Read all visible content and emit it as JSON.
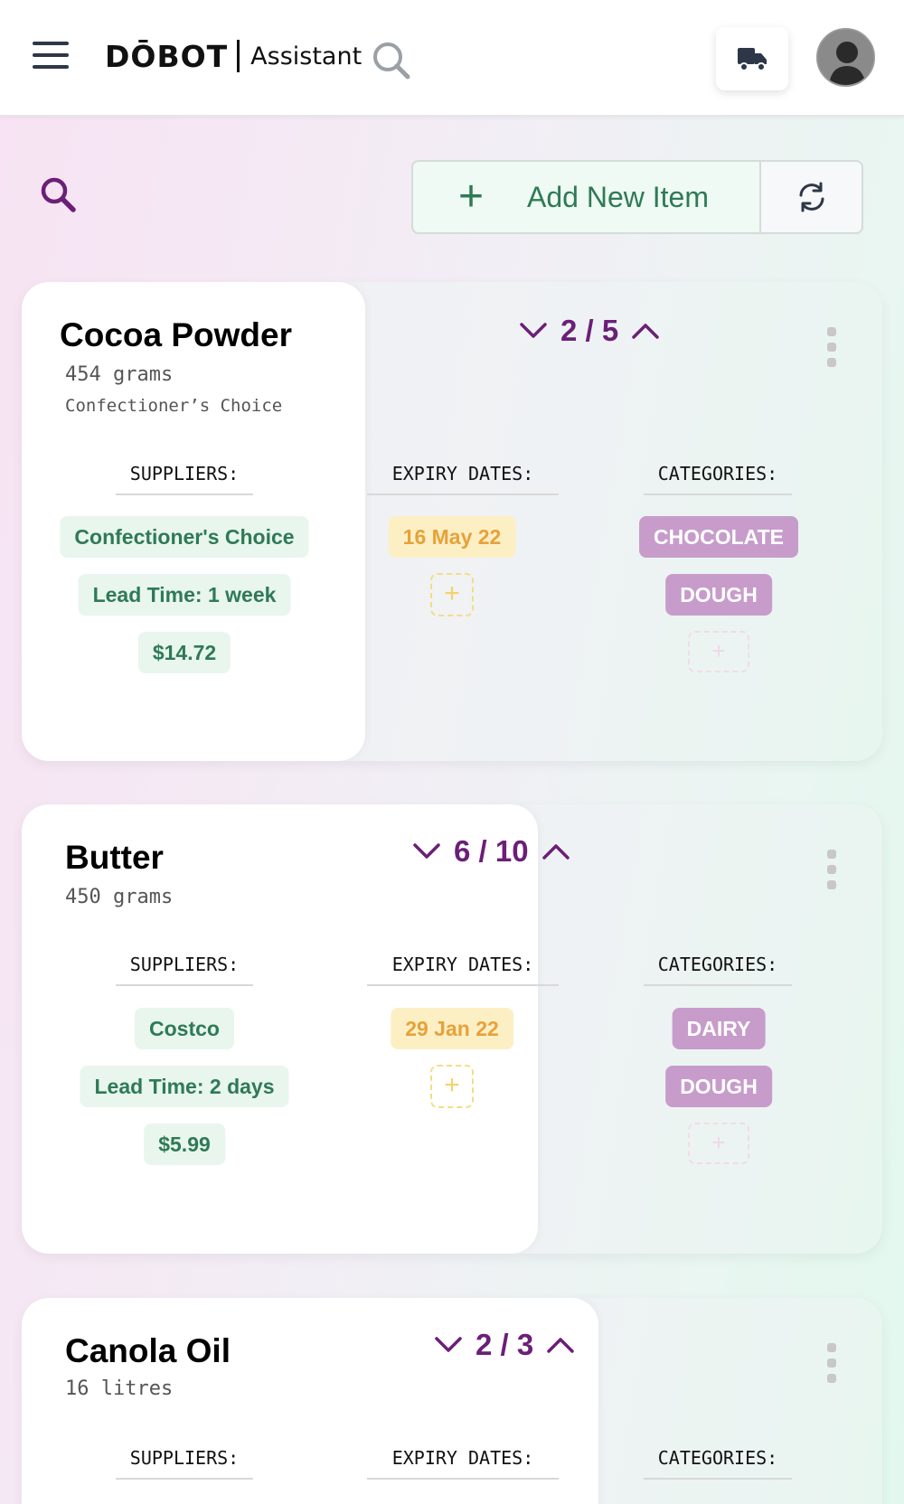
{
  "header": {
    "brand": "DŌBOT",
    "brand_sub": "Assistant",
    "menu_icon": "hamburger-menu-icon",
    "search_icon": "search-icon",
    "truck_icon": "delivery-truck-icon",
    "avatar_icon": "user-avatar-icon"
  },
  "toolbar": {
    "search_icon": "search-icon",
    "add_plus": "+",
    "add_label": "Add New Item",
    "refresh_icon": "refresh-icon"
  },
  "columns": {
    "suppliers": "SUPPLIERS:",
    "expiry": "EXPIRY DATES:",
    "categories": "CATEGORIES:"
  },
  "items": [
    {
      "name": "Cocoa Powder",
      "quantity": "454 grams",
      "brand": "Confectioner’s Choice",
      "pager": "2 / 5",
      "supplier": "Confectioner's Choice",
      "lead_time": "Lead Time: 1 week",
      "price": "$14.72",
      "expiry_dates": [
        "16 May 22"
      ],
      "categories": [
        "CHOCOLATE",
        "DOUGH"
      ]
    },
    {
      "name": "Butter",
      "quantity": "450 grams",
      "pager": "6 / 10",
      "supplier": "Costco",
      "lead_time": "Lead Time: 2 days",
      "price": "$5.99",
      "expiry_dates": [
        "29 Jan 22"
      ],
      "categories": [
        "DAIRY",
        "DOUGH"
      ]
    },
    {
      "name": "Canola Oil",
      "quantity": "16 litres",
      "pager": "2 / 3"
    }
  ],
  "add_symbol": "+",
  "colors": {
    "accent_purple": "#6b1f77",
    "supplier_green": "#2f7a55",
    "expiry_orange": "#e6a23a",
    "category_purple": "#c79ccb"
  }
}
